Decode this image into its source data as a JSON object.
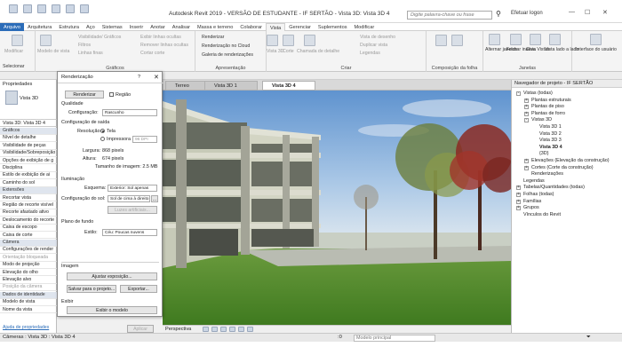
{
  "window": {
    "title": "Autodesk Revit 2019 - VERSÃO DE ESTUDANTE - IF SERTÃO - Vista 3D: Vista 3D 4",
    "search_placeholder": "Digite palavra-chave ou frase",
    "login": "Efetuar logon"
  },
  "ribbon_tabs": [
    "Arquivo",
    "Arquitetura",
    "Estrutura",
    "Aço",
    "Sistemas",
    "Inserir",
    "Anotar",
    "Analisar",
    "Massa e terreno",
    "Colaborar",
    "Vista",
    "Gerenciar",
    "Suplementos",
    "Modificar"
  ],
  "ribbon": {
    "modify": "Modificar",
    "selector": "Selecionar",
    "graphics_items": [
      "Modelo de vista",
      "Visibilidade/ Gráficos",
      "Filtros",
      "Linhas finas",
      "Exibir linhas ocultas",
      "Remover linhas ocultas",
      "Recortar vista",
      "Cortar corte"
    ],
    "graphics_label": "Gráficos",
    "presentation_items": [
      "Renderizar",
      "Renderização no Cloud",
      "Galeria de renderizações"
    ],
    "presentation_label": "Apresentação",
    "create_items": [
      "Vista 3D",
      "Corte",
      "Chamada de detalhe",
      "Vista de desenho",
      "Duplicar vista",
      "Legendas"
    ],
    "create_label": "Criar",
    "sheet_label": "Composição da folha",
    "window_items": [
      "Alternar janelas",
      "Fechar inativa",
      "Guia Vistas",
      "Vista lado a lado"
    ],
    "window_label": "Janelas",
    "ui_item": "Interface do usuário"
  },
  "properties": {
    "title": "Propriedades",
    "type": "Vista 3D",
    "selector": "Vista 3D: Vista 3D 4",
    "rows": [
      {
        "label": "Gráficos",
        "kind": "sec"
      },
      {
        "label": "Nível de detalhe",
        "kind": ""
      },
      {
        "label": "Visibilidade de peças",
        "kind": ""
      },
      {
        "label": "Visibilidade/Sobreposição",
        "kind": ""
      },
      {
        "label": "Opções de exibição de g",
        "kind": ""
      },
      {
        "label": "Disciplina",
        "kind": ""
      },
      {
        "label": "Estilo de exibição de ai",
        "kind": ""
      },
      {
        "label": "Caminho do sol",
        "kind": ""
      },
      {
        "label": "Extensões",
        "kind": "sec"
      },
      {
        "label": "Recortar vista",
        "kind": ""
      },
      {
        "label": "Região de recorte visível",
        "kind": ""
      },
      {
        "label": "Recorte afastado ativo",
        "kind": ""
      },
      {
        "label": "Deslocamento do recorte",
        "kind": ""
      },
      {
        "label": "Caixa de escopo",
        "kind": ""
      },
      {
        "label": "Caixa de corte",
        "kind": ""
      },
      {
        "label": "Câmera",
        "kind": "sec"
      },
      {
        "label": "Configurações de render",
        "kind": ""
      },
      {
        "label": "Orientação bloqueada",
        "kind": "dim"
      },
      {
        "label": "Modo de projeção",
        "kind": ""
      },
      {
        "label": "Elevação do olho",
        "kind": ""
      },
      {
        "label": "Elevação alvo",
        "kind": ""
      },
      {
        "label": "Posição da câmera",
        "kind": "dim"
      },
      {
        "label": "Dados de identidade",
        "kind": "sec"
      },
      {
        "label": "Modelo de vista",
        "kind": ""
      },
      {
        "label": "Nome da vista",
        "kind": ""
      }
    ],
    "help": "Ajuda de propriedades",
    "apply": "Aplicar"
  },
  "render_dialog": {
    "title": "Renderização",
    "help": "?",
    "render_btn": "Renderizar",
    "region": "Região",
    "quality": "Qualidade",
    "config_label": "Configuração:",
    "config_value": "Rascunho",
    "output": "Configuração de saída",
    "resolution": "Resolução:",
    "screen": "Tela",
    "printer": "Impressora",
    "dpi": "96 DPI",
    "width_label": "Largura:",
    "width_value": "868 pixels",
    "height_label": "Altura:",
    "height_value": "674 pixels",
    "size_label": "Tamanho de imagem: 2.5 MB",
    "lighting": "Iluminação",
    "scheme_label": "Esquema:",
    "scheme_value": "Exterior: Sol apenas",
    "sun_label": "Configuração do sol:",
    "sun_value": "Sol de cima à direito",
    "artificial": "Luzes artificiais...",
    "background": "Plano de fundo",
    "style_label": "Estilo:",
    "style_value": "Céu: Poucas nuvens",
    "image": "Imagem",
    "adjust": "Ajustar exposição...",
    "save_project": "Salvar para o projeto...",
    "export": "Exportar...",
    "display": "Exibir",
    "show_model": "Exibir o modelo"
  },
  "view_tabs": [
    "Terreo",
    "Vista 3D 1",
    "Vista 3D 4"
  ],
  "view_bar": {
    "label": "Perspectiva"
  },
  "browser": {
    "title": "Navegador de projeto - IF SERTÃO",
    "items": [
      {
        "text": "Vistas (todas)",
        "level": 0,
        "toggle": "-",
        "bold": false
      },
      {
        "text": "Plantas estruturais",
        "level": 1,
        "toggle": "+",
        "bold": false
      },
      {
        "text": "Plantas de piso",
        "level": 1,
        "toggle": "+",
        "bold": false
      },
      {
        "text": "Plantas de forro",
        "level": 1,
        "toggle": "+",
        "bold": false
      },
      {
        "text": "Vistas 3D",
        "level": 1,
        "toggle": "-",
        "bold": false
      },
      {
        "text": "Vista 3D 1",
        "level": 2,
        "toggle": "",
        "bold": false
      },
      {
        "text": "Vista 3D 2",
        "level": 2,
        "toggle": "",
        "bold": false
      },
      {
        "text": "Vista 3D 3",
        "level": 2,
        "toggle": "",
        "bold": false
      },
      {
        "text": "Vista 3D 4",
        "level": 2,
        "toggle": "",
        "bold": true
      },
      {
        "text": "{3D}",
        "level": 2,
        "toggle": "",
        "bold": false
      },
      {
        "text": "Elevações (Elevação da construção)",
        "level": 1,
        "toggle": "+",
        "bold": false
      },
      {
        "text": "Cortes (Corte da construção)",
        "level": 1,
        "toggle": "+",
        "bold": false
      },
      {
        "text": "Renderizações",
        "level": 1,
        "toggle": "",
        "bold": false
      },
      {
        "text": "Legendas",
        "level": 0,
        "toggle": "",
        "bold": false
      },
      {
        "text": "Tabelas/Quantidades (todas)",
        "level": 0,
        "toggle": "+",
        "bold": false
      },
      {
        "text": "Folhas (todas)",
        "level": 0,
        "toggle": "+",
        "bold": false
      },
      {
        "text": "Famílias",
        "level": 0,
        "toggle": "+",
        "bold": false
      },
      {
        "text": "Grupos",
        "level": 0,
        "toggle": "+",
        "bold": false
      },
      {
        "text": "Vínculos do Revit",
        "level": 0,
        "toggle": "",
        "bold": false
      }
    ]
  },
  "status": {
    "left": "Câmeras : Vista 3D : Vista 3D 4",
    "coords": ":0",
    "model": "Modelo principal"
  },
  "colors": {
    "accent": "#2b6cb8",
    "sky_top": "#6fa0d4",
    "grass": "#4f8a2c"
  }
}
